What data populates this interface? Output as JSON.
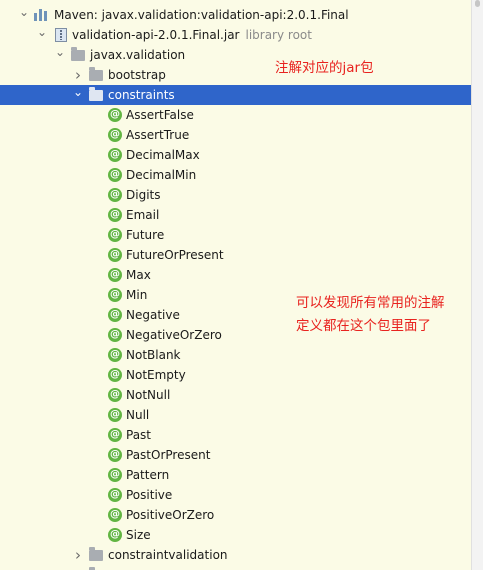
{
  "tree": {
    "library": {
      "label": "Maven: javax.validation:validation-api:2.0.1.Final"
    },
    "jar": {
      "label": "validation-api-2.0.1.Final.jar",
      "suffix": "library root"
    },
    "package": {
      "label": "javax.validation"
    },
    "bootstrap": {
      "label": "bootstrap"
    },
    "constraints": {
      "label": "constraints"
    },
    "annotations": [
      "AssertFalse",
      "AssertTrue",
      "DecimalMax",
      "DecimalMin",
      "Digits",
      "Email",
      "Future",
      "FutureOrPresent",
      "Max",
      "Min",
      "Negative",
      "NegativeOrZero",
      "NotBlank",
      "NotEmpty",
      "NotNull",
      "Null",
      "Past",
      "PastOrPresent",
      "Pattern",
      "Positive",
      "PositiveOrZero",
      "Size"
    ],
    "constraintvalidation": {
      "label": "constraintvalidation"
    },
    "annotation_icon_glyph": "@"
  },
  "notes": {
    "jar_note": "注解对应的jar包",
    "package_note_line1": "可以发现所有常用的注解",
    "package_note_line2": "定义都在这个包里面了"
  },
  "colors": {
    "background": "#fbfbe6",
    "selection": "#2f65ca",
    "annotation_icon": "#62b543",
    "note_text": "#e8231f"
  }
}
